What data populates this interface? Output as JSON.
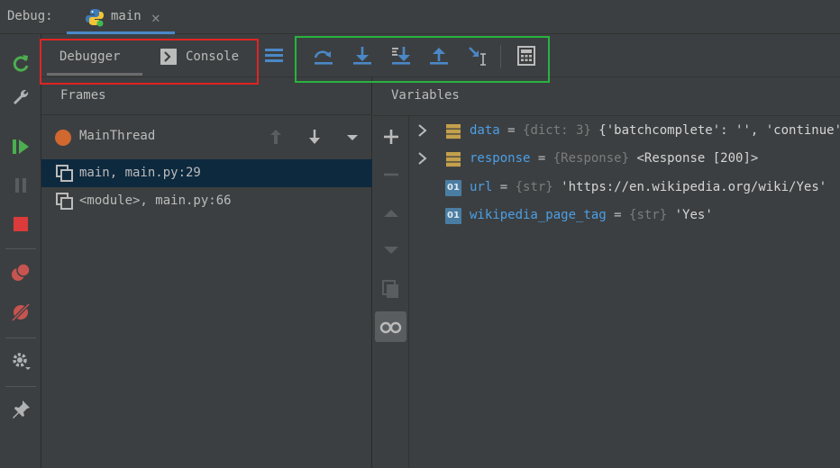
{
  "header": {
    "debug_label": "Debug:",
    "run_tab": "main"
  },
  "tabs": {
    "debugger": "Debugger",
    "console": "Console"
  },
  "frames": {
    "title": "Frames",
    "thread": "MainThread",
    "items": [
      "main, main.py:29",
      "<module>, main.py:66"
    ]
  },
  "variables": {
    "title": "Variables",
    "items": [
      {
        "name": "data",
        "eq": " = ",
        "type": "{dict: 3}",
        "value": " {'batchcomplete': '', 'continue': {'",
        "icon": "dict-icon",
        "expandable": true
      },
      {
        "name": "response",
        "eq": " = ",
        "type": "{Response}",
        "value": " <Response [200]>",
        "icon": "object-icon",
        "expandable": true
      },
      {
        "name": "url",
        "eq": " = ",
        "type": "{str}",
        "value": " 'https://en.wikipedia.org/wiki/Yes'",
        "icon": "str-icon",
        "expandable": false
      },
      {
        "name": "wikipedia_page_tag",
        "eq": " = ",
        "type": "{str}",
        "value": " 'Yes'",
        "icon": "str-icon",
        "expandable": false
      }
    ]
  },
  "icons": {
    "str_badge": "01"
  },
  "colors": {
    "accent": "#4a88c7",
    "variable_name": "#4b9fe5",
    "selection": "#0d293e",
    "highlight_red": "#e02424",
    "highlight_green": "#27b33e"
  }
}
